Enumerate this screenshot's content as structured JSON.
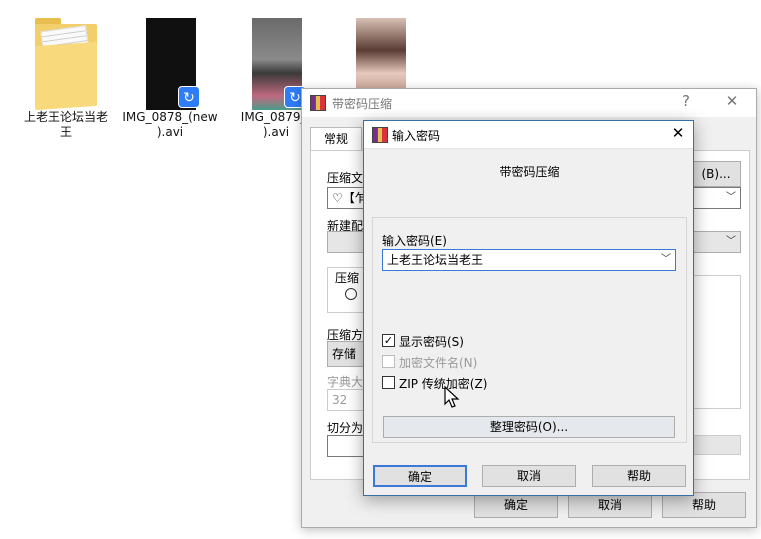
{
  "desktop": {
    "files": [
      {
        "name": "上老王论坛当老\n王",
        "type": "folder"
      },
      {
        "name": "IMG_0878_(new\n).avi",
        "type": "video"
      },
      {
        "name": "IMG_0879_(\n).avi",
        "type": "video"
      },
      {
        "name": "",
        "type": "video"
      }
    ]
  },
  "back_dialog": {
    "title": "带密码压缩",
    "help": "?",
    "close": "✕",
    "tab_general": "常规",
    "archive_name_label": "压缩文",
    "archive_name_value": "♡【乍",
    "browse_button": "(B)...",
    "new_profile_label": "新建配",
    "format_label": "压缩",
    "method_label": "压缩方",
    "method_value": "存储",
    "dict_label": "字典大",
    "dict_value": "32",
    "split_label": "切分为",
    "ok": "确定",
    "cancel": "取消",
    "help_button": "帮助"
  },
  "pwd_dialog": {
    "title": "输入密码",
    "close": "✕",
    "heading": "带密码压缩",
    "password_label": "输入密码(E)",
    "password_value": "上老王论坛当老王",
    "show_password": "显示密码(S)",
    "show_password_checked": true,
    "encrypt_names": "加密文件名(N)",
    "zip_legacy": "ZIP 传统加密(Z)",
    "organize_button": "整理密码(O)...",
    "ok": "确定",
    "cancel": "取消",
    "help": "帮助"
  }
}
